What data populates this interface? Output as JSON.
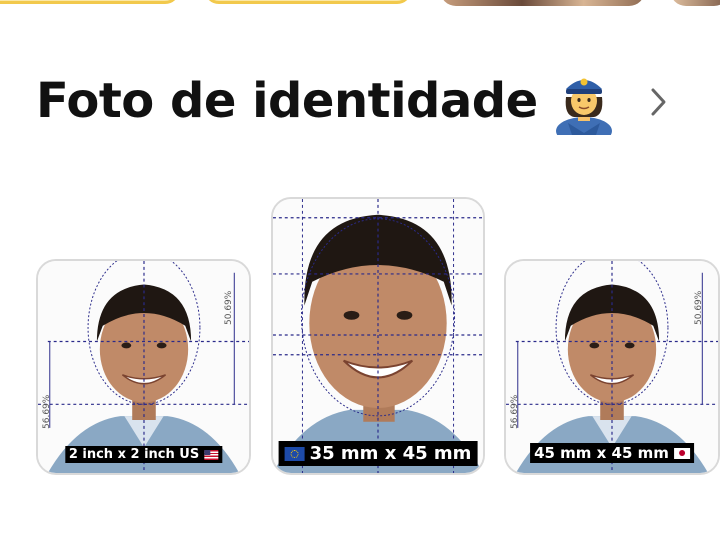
{
  "section": {
    "title": "Foto de identidade",
    "title_icon": "police-officer-icon",
    "more_icon": "chevron-right-icon"
  },
  "cards": [
    {
      "label": "2 inch x 2 inch US",
      "flag": "us-flag-icon",
      "guide_top": "50.69%",
      "guide_bottom": "56.69%"
    },
    {
      "label": "35 mm x 45 mm",
      "flag": "eu-flag-icon"
    },
    {
      "label": "45 mm x 45 mm",
      "flag": "jp-flag-icon",
      "guide_top": "50.69%",
      "guide_bottom": "56.69%"
    }
  ],
  "colors": {
    "top_pill_fill": "#fbe8a6",
    "top_pill_border": "#f2c94c",
    "guide_line": "#2a2a8a",
    "label_bg": "#000000",
    "card_border": "#d9d9d9"
  }
}
